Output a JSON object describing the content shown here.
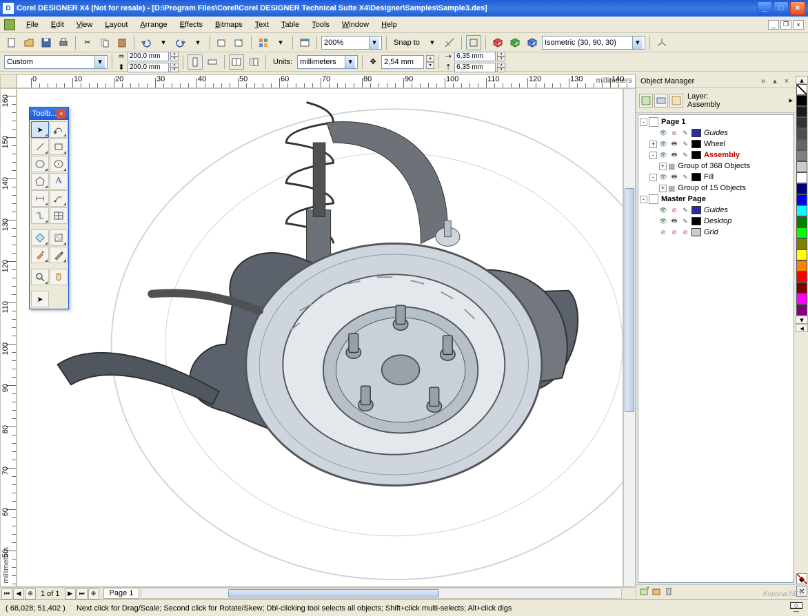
{
  "title": "Corel DESIGNER X4 (Not for resale) - [D:\\Program Files\\Corel\\Corel DESIGNER Technical Suite X4\\Designer\\Samples\\Sample3.des]",
  "menu": [
    "File",
    "Edit",
    "View",
    "Layout",
    "Arrange",
    "Effects",
    "Bitmaps",
    "Text",
    "Table",
    "Tools",
    "Window",
    "Help"
  ],
  "toolbar1": {
    "zoom": "200%",
    "snap_label": "Snap to",
    "projection": "Isometric (30, 90, 30)"
  },
  "toolbar2": {
    "preset": "Custom",
    "width": "200,0 mm",
    "height": "200,0 mm",
    "units_label": "Units:",
    "units": "millimeters",
    "nudge": "2,54 mm",
    "dup_x": "6,35 mm",
    "dup_y": "6,35 mm"
  },
  "ruler_unit": "millimeters",
  "ruler_h_ticks": [
    0,
    10,
    20,
    30,
    40,
    50,
    60,
    70,
    80,
    90,
    100,
    110,
    120,
    130,
    140
  ],
  "ruler_v_ticks": [
    160,
    150,
    140,
    130,
    120,
    110,
    100,
    90,
    80,
    70,
    60,
    50
  ],
  "toolbox_title": "Toolb...",
  "panel": {
    "title": "Object Manager",
    "layer_label": "Layer:",
    "layer_name": "Assembly",
    "tree": [
      {
        "d": 0,
        "exp": "-",
        "type": "page",
        "label": "Page 1",
        "bold": true
      },
      {
        "d": 1,
        "eye": true,
        "print": false,
        "pen": true,
        "swatch": "#2c2c9c",
        "label": "Guides",
        "italic": true
      },
      {
        "d": 1,
        "exp": "+",
        "eye": true,
        "print": true,
        "pen": true,
        "swatch": "#000000",
        "label": "Wheel"
      },
      {
        "d": 1,
        "exp": "-",
        "eye": true,
        "print": true,
        "pen": true,
        "swatch": "#000000",
        "label": "Assembly",
        "bold": true,
        "red": true
      },
      {
        "d": 2,
        "exp": "+",
        "obj": true,
        "label": "Group of 368 Objects"
      },
      {
        "d": 1,
        "exp": "-",
        "eye": true,
        "print": true,
        "pen": true,
        "swatch": "#000000",
        "label": "Fill"
      },
      {
        "d": 2,
        "exp": "+",
        "obj": true,
        "label": "Group of 15 Objects"
      },
      {
        "d": 0,
        "exp": "-",
        "type": "page",
        "label": "Master Page",
        "bold": true
      },
      {
        "d": 1,
        "eye": true,
        "print": false,
        "pen": true,
        "swatch": "#2c2c9c",
        "label": "Guides",
        "italic": true
      },
      {
        "d": 1,
        "eye": true,
        "print": true,
        "pen": true,
        "swatch": "#000000",
        "label": "Desktop",
        "italic": true
      },
      {
        "d": 1,
        "eye": false,
        "print": false,
        "pen": false,
        "swatch": null,
        "label": "Grid",
        "italic": true
      }
    ]
  },
  "colors": [
    "#000000",
    "#1a1a1a",
    "#333333",
    "#4d4d4d",
    "#666666",
    "#808080",
    "#cccccc",
    "#ffffff",
    "#000080",
    "#0000ff",
    "#00ffff",
    "#008000",
    "#00ff00",
    "#808000",
    "#ffff00",
    "#ff8000",
    "#ff0000",
    "#800000",
    "#ff00ff",
    "#800080"
  ],
  "page_nav": {
    "text": "1 of 1",
    "tab": "Page 1"
  },
  "status": {
    "coords": "( 68,028; 51,402 )",
    "hint": "Next click for Drag/Scale; Second click for Rotate/Skew; Dbl-clicking tool selects all objects; Shift+click multi-selects; Alt+click digs"
  },
  "watermark": "Kopona.NET."
}
